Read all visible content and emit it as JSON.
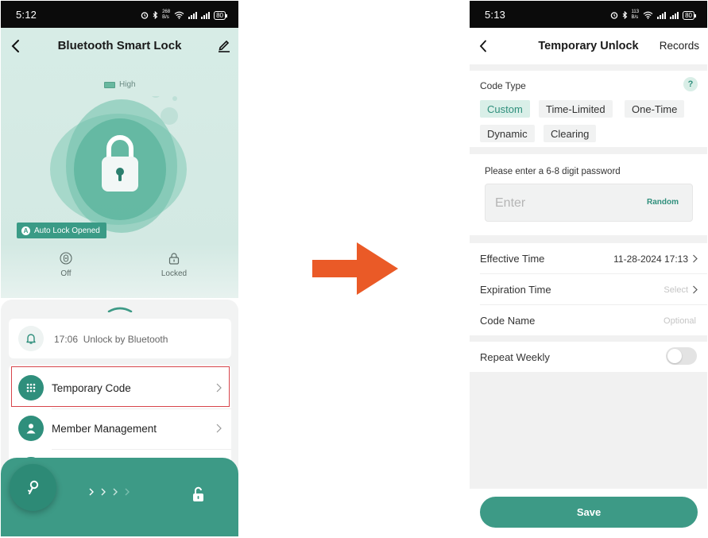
{
  "left_screen": {
    "status_bar": {
      "time": "5:12",
      "net_speed_top": "268",
      "net_speed_unit": "B/s",
      "battery": "80"
    },
    "header": {
      "title": "Bluetooth Smart Lock"
    },
    "battery_level": "High",
    "auto_lock_badge": {
      "icon_letter": "A",
      "text": "Auto Lock Opened"
    },
    "stats": [
      {
        "icon": "privacy-lock-icon",
        "label": "Off"
      },
      {
        "icon": "padlock-icon",
        "label": "Locked"
      }
    ],
    "notification": {
      "time": "17:06",
      "text": "Unlock by Bluetooth"
    },
    "menu": [
      {
        "label": "Temporary Code",
        "icon": "keypad-icon"
      },
      {
        "label": "Member Management",
        "icon": "user-icon"
      }
    ]
  },
  "right_screen": {
    "status_bar": {
      "time": "5:13",
      "net_speed_top": "113",
      "net_speed_unit": "B/s",
      "battery": "80"
    },
    "header": {
      "title": "Temporary Unlock",
      "records_label": "Records"
    },
    "code_type": {
      "label": "Code Type",
      "help": "?",
      "options": [
        "Custom",
        "Time-Limited",
        "One-Time",
        "Dynamic",
        "Clearing"
      ],
      "selected": "Custom"
    },
    "password": {
      "label": "Please enter a 6-8 digit password",
      "placeholder": "Enter",
      "random_label": "Random"
    },
    "effective_time": {
      "label": "Effective Time",
      "value": "11-28-2024 17:13"
    },
    "expiration_time": {
      "label": "Expiration Time",
      "placeholder": "Select"
    },
    "code_name": {
      "label": "Code Name",
      "placeholder": "Optional"
    },
    "repeat_weekly": {
      "label": "Repeat Weekly",
      "enabled": false
    },
    "save_label": "Save"
  },
  "colors": {
    "brand_teal": "#3d9a86",
    "arrow_orange": "#ea5a27",
    "highlight_red": "#d7454b"
  }
}
